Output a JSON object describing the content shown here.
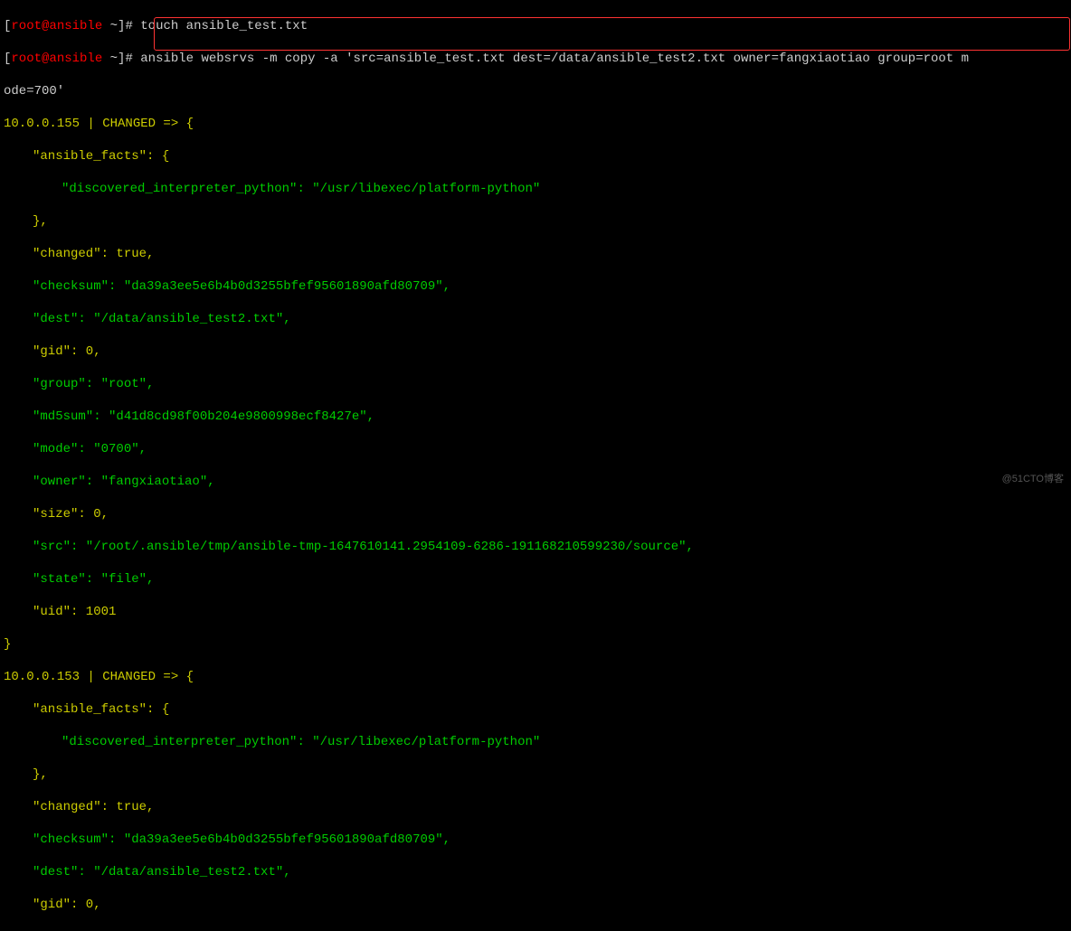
{
  "prompt": {
    "open": "[",
    "user": "root",
    "at": "@",
    "host": "ansible",
    "space": " ",
    "tilde": "~",
    "close": "]",
    "hash": "# "
  },
  "cmd1": "touch ansible_test.txt",
  "cmd2a": "ansible websrvs -m copy -a 'src=ansible_test.txt dest=/data/ansible_test2.txt owner=fangxiaotiao group=root m",
  "cmd2b": "ode=700'",
  "host1": {
    "header": "10.0.0.155 | CHANGED => {",
    "facts_open": "\"ansible_facts\": {",
    "interp": "\"discovered_interpreter_python\": \"/usr/libexec/platform-python\"",
    "close_brace": "},",
    "changed": "\"changed\": true,",
    "checksum": "\"checksum\": \"da39a3ee5e6b4b0d3255bfef95601890afd80709\",",
    "dest": "\"dest\": \"/data/ansible_test2.txt\",",
    "gid": "\"gid\": 0,",
    "group": "\"group\": \"root\",",
    "md5sum": "\"md5sum\": \"d41d8cd98f00b204e9800998ecf8427e\",",
    "mode": "\"mode\": \"0700\",",
    "owner": "\"owner\": \"fangxiaotiao\",",
    "size": "\"size\": 0,",
    "src": "\"src\": \"/root/.ansible/tmp/ansible-tmp-1647610141.2954109-6286-191168210599230/source\",",
    "state": "\"state\": \"file\",",
    "uid": "\"uid\": 1001",
    "end": "}"
  },
  "host2": {
    "header": "10.0.0.153 | CHANGED => {",
    "facts_open": "\"ansible_facts\": {",
    "interp": "\"discovered_interpreter_python\": \"/usr/libexec/platform-python\"",
    "close_brace": "},",
    "changed": "\"changed\": true,",
    "checksum": "\"checksum\": \"da39a3ee5e6b4b0d3255bfef95601890afd80709\",",
    "dest": "\"dest\": \"/data/ansible_test2.txt\",",
    "gid": "\"gid\": 0,"
  },
  "watermark": "@51CTO博客"
}
